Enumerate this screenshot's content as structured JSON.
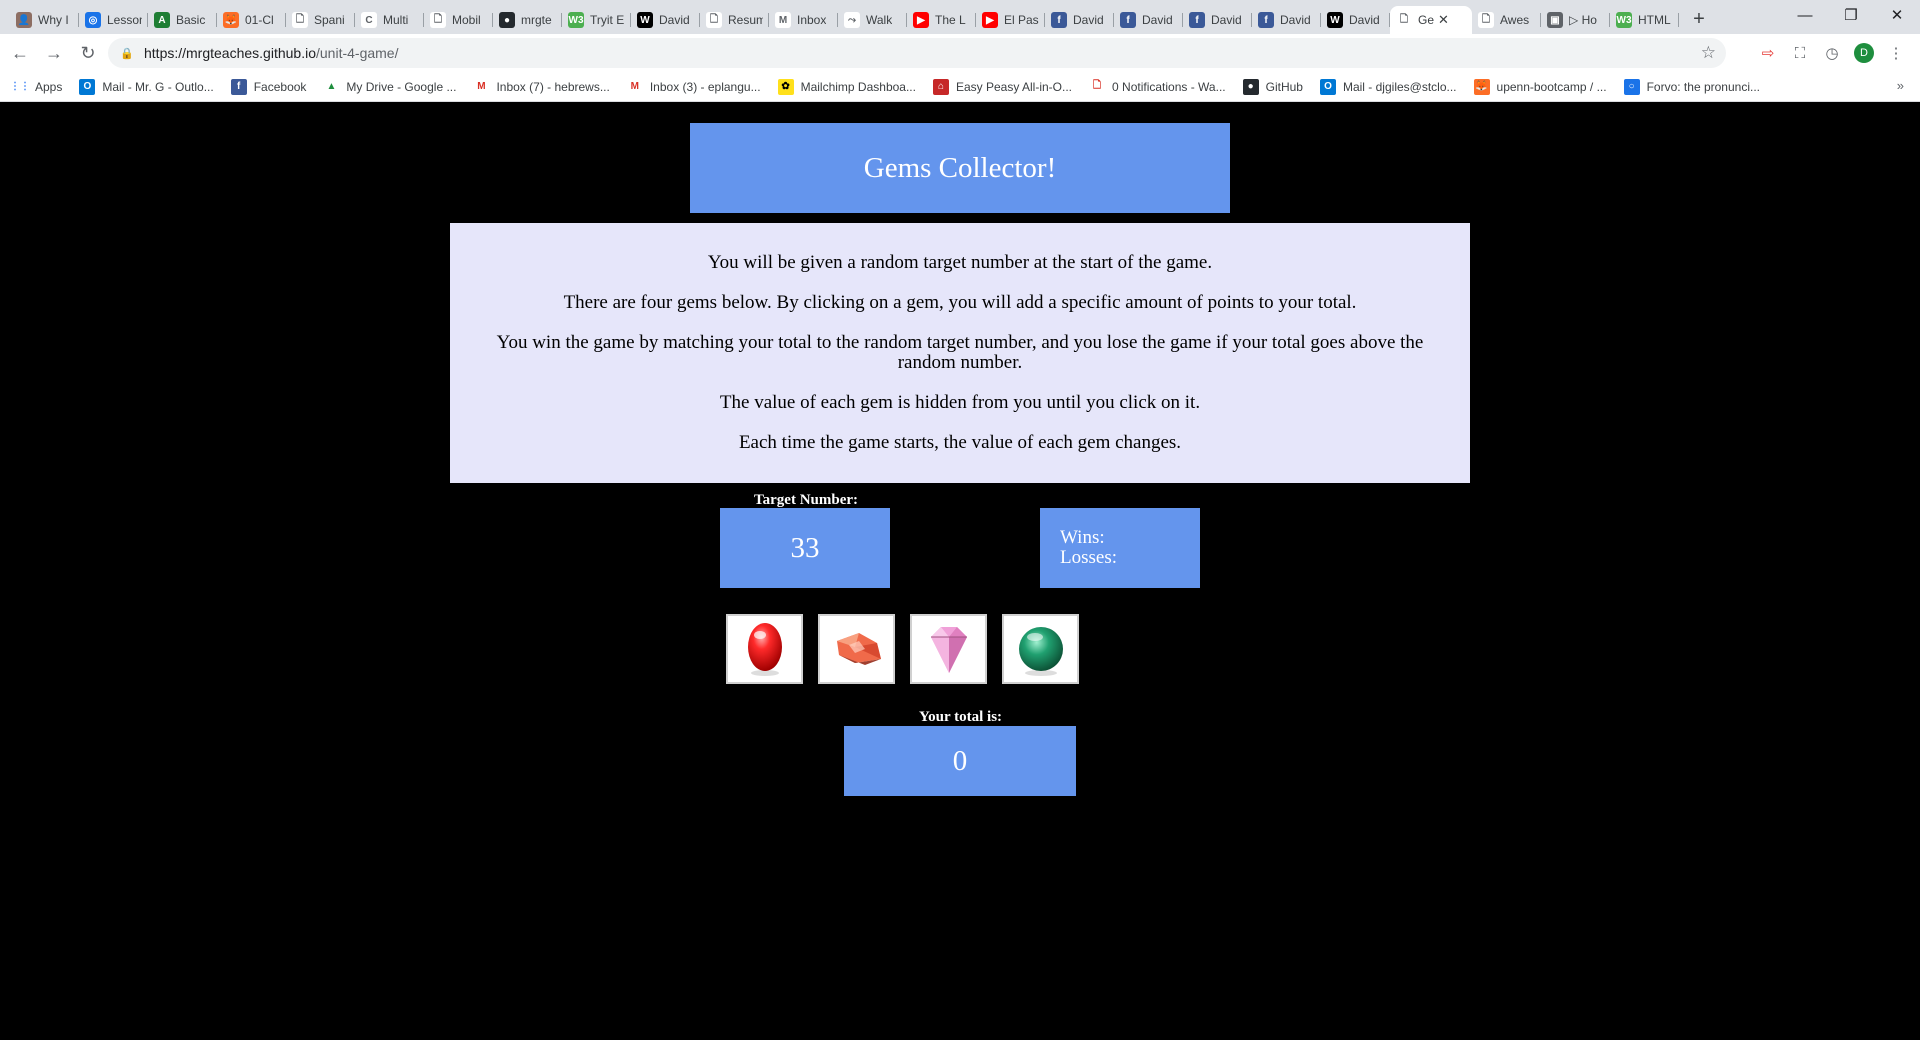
{
  "browser": {
    "tabs": [
      {
        "title": "Why I",
        "color": "#8d6e63",
        "glyph": "👤"
      },
      {
        "title": "Lessons",
        "color": "#1a73e8",
        "glyph": "◎"
      },
      {
        "title": "Basic",
        "color": "#1e7e34",
        "glyph": "A"
      },
      {
        "title": "01-Cl",
        "color": "#fc6d26",
        "glyph": "🦊"
      },
      {
        "title": "Spani",
        "color": "#ffffff",
        "glyph": "🗋"
      },
      {
        "title": "Multi",
        "color": "#ffffff",
        "glyph": "C"
      },
      {
        "title": "Mobil",
        "color": "#ffffff",
        "glyph": "🗋"
      },
      {
        "title": "mrgte",
        "color": "#24292e",
        "glyph": "●"
      },
      {
        "title": "Tryit E",
        "color": "#4caf50",
        "glyph": "W3"
      },
      {
        "title": "David",
        "color": "#000000",
        "glyph": "W"
      },
      {
        "title": "Resum",
        "color": "#ffffff",
        "glyph": "🗋"
      },
      {
        "title": "Inbox",
        "color": "#ffffff",
        "glyph": "M"
      },
      {
        "title": "Walk",
        "color": "#ffffff",
        "glyph": "⤳"
      },
      {
        "title": "The L",
        "color": "#ff0000",
        "glyph": "▶"
      },
      {
        "title": "El Pas",
        "color": "#ff0000",
        "glyph": "▶"
      },
      {
        "title": "David",
        "color": "#3b5998",
        "glyph": "f"
      },
      {
        "title": "David",
        "color": "#3b5998",
        "glyph": "f"
      },
      {
        "title": "David",
        "color": "#3b5998",
        "glyph": "f"
      },
      {
        "title": "David",
        "color": "#3b5998",
        "glyph": "f"
      },
      {
        "title": "David",
        "color": "#000000",
        "glyph": "W"
      }
    ],
    "active_tab": {
      "title": "Ge",
      "close": "✕"
    },
    "tabs_after": [
      {
        "title": "Awes",
        "color": "#ffffff",
        "glyph": "🗋"
      },
      {
        "title": "▷ Ho",
        "color": "#5f6368",
        "glyph": "▣"
      },
      {
        "title": "HTML",
        "color": "#4caf50",
        "glyph": "W3"
      }
    ],
    "new_tab": "+",
    "window_controls": {
      "minimize": "—",
      "restore": "❐",
      "close": "✕"
    },
    "url_host": "https://mrgteaches.github.io",
    "url_path": "/unit-4-game/",
    "profile_initial": "D",
    "bookmarks": [
      {
        "label": "Apps",
        "color": "#ea4335",
        "glyph": "⋮⋮"
      },
      {
        "label": "Mail - Mr. G - Outlo...",
        "color": "#0078d4",
        "glyph": "O"
      },
      {
        "label": "Facebook",
        "color": "#3b5998",
        "glyph": "f"
      },
      {
        "label": "My Drive - Google ...",
        "color": "#fbbc04",
        "glyph": "▲"
      },
      {
        "label": "Inbox (7) - hebrews...",
        "color": "#ffffff",
        "glyph": "M"
      },
      {
        "label": "Inbox (3) - eplangu...",
        "color": "#ffffff",
        "glyph": "M"
      },
      {
        "label": "Mailchimp Dashboa...",
        "color": "#ffe01b",
        "glyph": "✿"
      },
      {
        "label": "Easy Peasy All-in-O...",
        "color": "#c62828",
        "glyph": "⌂"
      },
      {
        "label": "0 Notifications - Wa...",
        "color": "#ffffff",
        "glyph": "🗋"
      },
      {
        "label": "GitHub",
        "color": "#24292e",
        "glyph": "●"
      },
      {
        "label": "Mail - djgiles@stclo...",
        "color": "#0078d4",
        "glyph": "O"
      },
      {
        "label": "upenn-bootcamp / ...",
        "color": "#fc6d26",
        "glyph": "🦊"
      },
      {
        "label": "Forvo: the pronunci...",
        "color": "#1a73e8",
        "glyph": "○"
      }
    ],
    "bookmarks_more": "»"
  },
  "game": {
    "title": "Gems Collector!",
    "instructions": [
      "You will be given a random target number at the start of the game.",
      "There are four gems below. By clicking on a gem, you will add a specific amount of points to your total.",
      "You win the game by matching your total to the random target number, and you lose the game if your total goes above the random number.",
      "The value of each gem is hidden from you until you click on it.",
      "Each time the game starts, the value of each gem changes."
    ],
    "target_label": "Target Number:",
    "target_value": "33",
    "wins_label": "Wins:",
    "losses_label": "Losses:",
    "total_label": "Your total is:",
    "total_value": "0",
    "gems": [
      {
        "name": "red-gem-icon",
        "color": "#e00000"
      },
      {
        "name": "orange-gem-icon",
        "color": "#f06a4a"
      },
      {
        "name": "pink-diamond-icon",
        "color": "#f0a0d8"
      },
      {
        "name": "green-gem-icon",
        "color": "#1a9a6a"
      }
    ]
  }
}
